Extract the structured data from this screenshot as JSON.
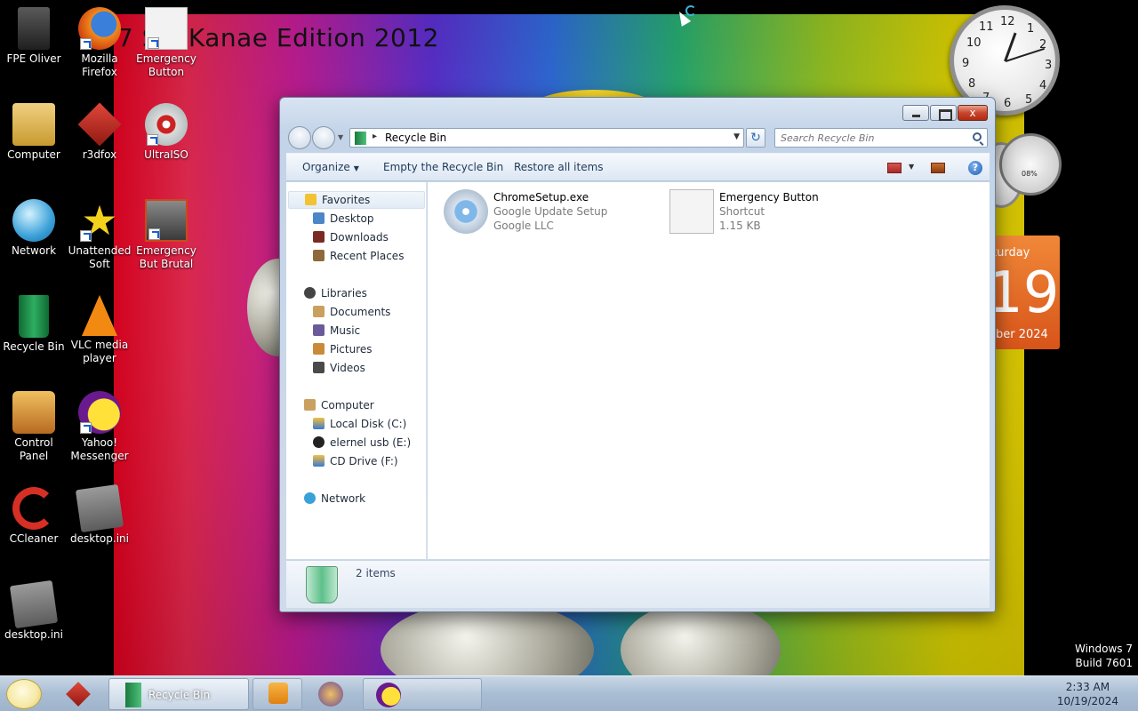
{
  "desktop": {
    "wallpaper_title": "7 SkaKanae Edition 2012",
    "watermark_line1": "Windows 7",
    "watermark_line2": "Build 7601",
    "icons": [
      {
        "label": "FPE Oliver",
        "icon": "user-folder-icon"
      },
      {
        "label": "Mozilla Firefox",
        "icon": "firefox-icon"
      },
      {
        "label": "Emergency Button",
        "icon": "emergency-button-icon"
      },
      {
        "label": "Computer",
        "icon": "computer-icon"
      },
      {
        "label": "r3dfox",
        "icon": "r3dfox-icon"
      },
      {
        "label": "UltraISO",
        "icon": "ultraiso-icon"
      },
      {
        "label": "Network",
        "icon": "network-globe-icon"
      },
      {
        "label": "Unattended Soft",
        "icon": "star-icon"
      },
      {
        "label": "Emergency But Brutal",
        "icon": "emergency-brutal-icon"
      },
      {
        "label": "Recycle Bin",
        "icon": "recycle-bin-icon"
      },
      {
        "label": "VLC media player",
        "icon": "vlc-cone-icon"
      },
      {
        "label": "Control Panel",
        "icon": "control-panel-icon"
      },
      {
        "label": "Yahoo! Messenger",
        "icon": "yahoo-messenger-icon"
      },
      {
        "label": "CCleaner",
        "icon": "ccleaner-icon"
      },
      {
        "label": "desktop.ini",
        "icon": "config-file-icon"
      },
      {
        "label": "desktop.ini",
        "icon": "config-file-icon"
      }
    ]
  },
  "gadgets": {
    "clock_numbers": [
      "12",
      "1",
      "2",
      "3",
      "4",
      "5",
      "6",
      "7",
      "8",
      "9",
      "10",
      "11"
    ],
    "calendar": {
      "day": "turday",
      "date": "19",
      "month": "ber 2024"
    },
    "cpu_meter_value": "08%"
  },
  "window": {
    "address_path": "Recycle Bin",
    "search_placeholder": "Search Recycle Bin",
    "close_glyph": "x",
    "refresh_glyph": "↻",
    "help_glyph": "?",
    "toolbar": {
      "organize": "Organize",
      "empty": "Empty the Recycle Bin",
      "restore": "Restore all items"
    },
    "nav": {
      "favorites": "Favorites",
      "desktop": "Desktop",
      "downloads": "Downloads",
      "recent": "Recent Places",
      "libraries": "Libraries",
      "documents": "Documents",
      "music": "Music",
      "pictures": "Pictures",
      "videos": "Videos",
      "computer": "Computer",
      "local_disk": "Local Disk (C:)",
      "usb": "elernel usb (E:)",
      "cd": "CD Drive (F:)",
      "network": "Network"
    },
    "items": [
      {
        "name": "ChromeSetup.exe",
        "line2": "Google Update Setup",
        "line3": "Google LLC",
        "icon": "installer-disc-icon"
      },
      {
        "name": "Emergency Button",
        "line2": "Shortcut",
        "line3": "1.15 KB",
        "icon": "shortcut-icon"
      }
    ],
    "status_count": "2 items"
  },
  "taskbar": {
    "active_label": "Recycle Bin",
    "time": "2:33 AM",
    "date": "10/19/2024"
  },
  "colors": {
    "accent": "#1e395b",
    "close_red": "#c9452c",
    "calendar_orange": "#e0662a"
  }
}
